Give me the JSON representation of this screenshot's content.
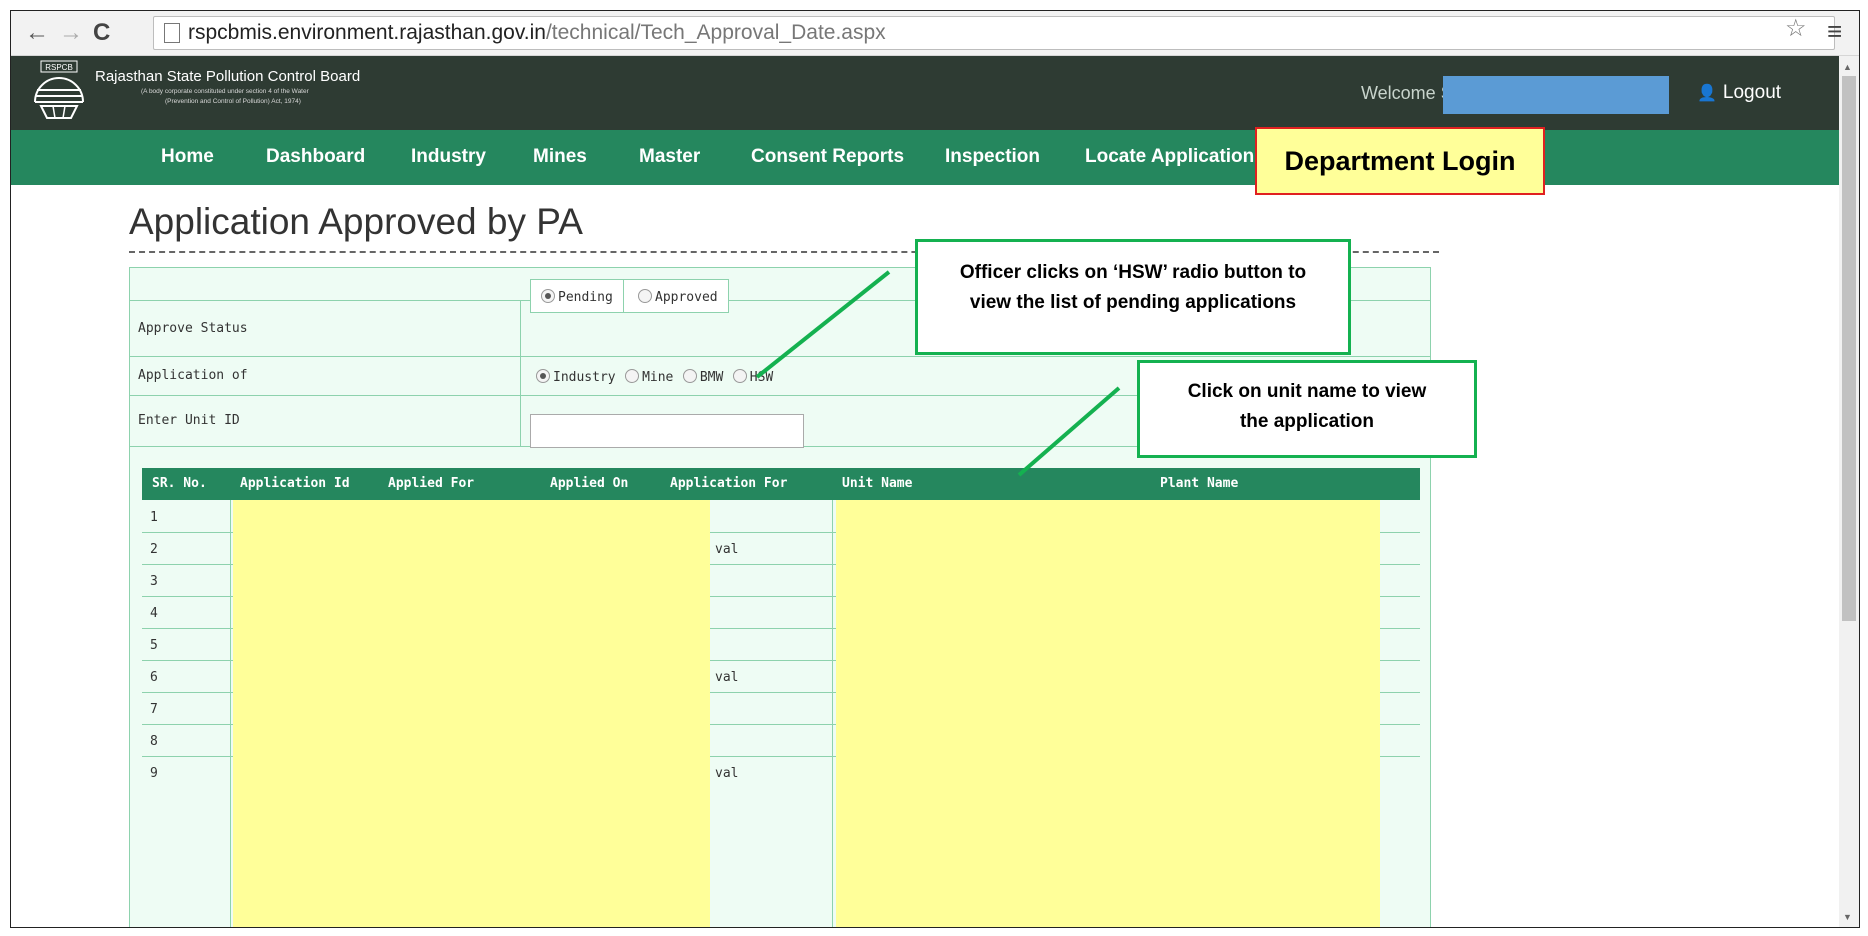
{
  "browser": {
    "back_icon": "arrow-left",
    "forward_icon": "arrow-right",
    "reload_icon": "reload",
    "url_host": "rspcbmis.environment.rajasthan.gov.in",
    "url_path": "/technical/Tech_Approval_Date.aspx"
  },
  "header": {
    "logo_text": "RSPCB",
    "org_name": "Rajasthan State Pollution Control Board",
    "org_sub1": "(A body corporate constituted under section 4 of the Water",
    "org_sub2": "(Prevention and Control of Pollution) Act, 1974)",
    "welcome": "Welcome S",
    "logout": "Logout"
  },
  "nav": {
    "items": [
      "Home",
      "Dashboard",
      "Industry",
      "Mines",
      "Master",
      "Consent Reports",
      "Inspection",
      "Locate Application"
    ]
  },
  "annotations": {
    "department_login": "Department Login",
    "hsw_callout_line1": "Officer clicks on ‘HSW’ radio button to",
    "hsw_callout_line2": "view the list of pending applications",
    "unit_callout_line1": "Click on unit name to view",
    "unit_callout_line2": "the application"
  },
  "page": {
    "title": "Application Approved by PA"
  },
  "form": {
    "approve_status_label": "Approve Status",
    "approve_options": [
      "Pending",
      "Approved"
    ],
    "approve_selected": "Pending",
    "application_of_label": "Application of",
    "application_options": [
      "Industry",
      "Mine",
      "BMW",
      "HSW"
    ],
    "application_selected": "Industry",
    "unit_id_label": "Enter Unit ID",
    "unit_id_value": ""
  },
  "table": {
    "columns": [
      "SR. No.",
      "Application Id",
      "Applied For",
      "Applied On",
      "Application For",
      "Unit Name",
      "Plant Name"
    ],
    "rows": [
      {
        "sr": "1",
        "application_for": ""
      },
      {
        "sr": "2",
        "application_for": "val"
      },
      {
        "sr": "3",
        "application_for": ""
      },
      {
        "sr": "4",
        "application_for": ""
      },
      {
        "sr": "5",
        "application_for": ""
      },
      {
        "sr": "6",
        "application_for": "val"
      },
      {
        "sr": "7",
        "application_for": ""
      },
      {
        "sr": "8",
        "application_for": ""
      },
      {
        "sr": "9",
        "application_for": "val"
      }
    ]
  },
  "colors": {
    "nav_green": "#25875e",
    "header_dark": "#2e3b33",
    "callout_green": "#14b150",
    "mask_yellow": "#ffff99",
    "mask_blue": "#5b9bd5"
  }
}
